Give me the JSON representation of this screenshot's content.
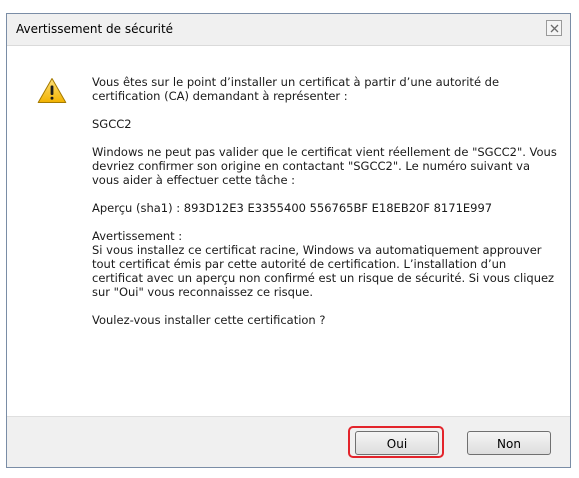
{
  "dialog": {
    "title": "Avertissement de sécurité",
    "icon": "warning-icon",
    "close_icon": "close-icon",
    "paragraphs": [
      "Vous êtes sur le point d’installer un certificat à partir d’une autorité de certification (CA) demandant à représenter :",
      "SGCC2",
      "Windows ne peut pas valider que le certificat vient réellement de \"SGCC2\". Vous devriez confirmer son origine en contactant \"SGCC2\". Le numéro suivant va vous aider à effectuer cette tâche :",
      "Aperçu (sha1) : 893D12E3 E3355400 556765BF E18EB20F 8171E997",
      "Avertissement :\nSi vous installez ce certificat racine, Windows va automatiquement approuver tout certificat émis par cette autorité de certification. L’installation d’un certificat avec un aperçu non confirmé est un risque de sécurité. Si vous cliquez sur \"Oui\" vous reconnaissez ce risque.",
      "Voulez-vous installer cette certification ?"
    ],
    "buttons": {
      "yes_label": "Oui",
      "no_label": "Non"
    },
    "colors": {
      "highlight": "#e3242b",
      "warning_fill": "#f5c518"
    }
  }
}
